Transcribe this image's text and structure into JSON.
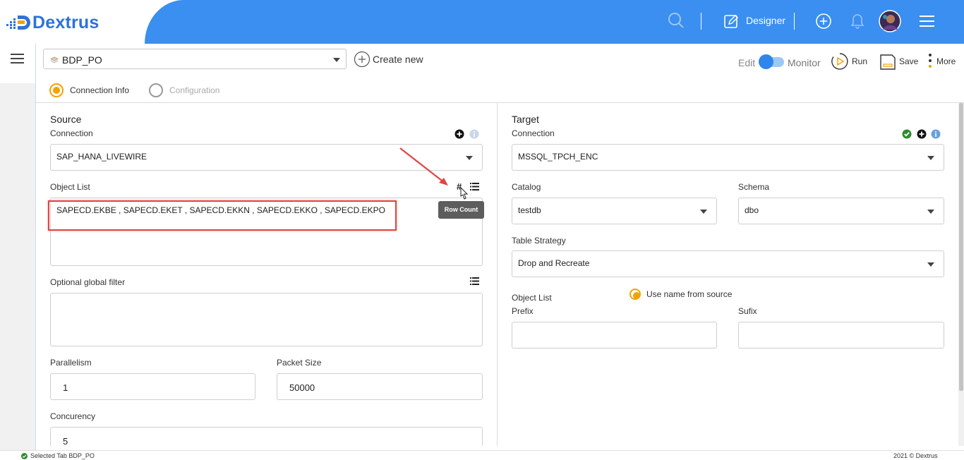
{
  "app": {
    "logo_text": "Dextrus"
  },
  "header": {
    "designer_label": "Designer"
  },
  "project": {
    "name": "BDP_PO",
    "create_new_label": "Create new"
  },
  "toolbar": {
    "edit_label": "Edit",
    "monitor_label": "Monitor",
    "run_label": "Run",
    "save_label": "Save",
    "more_label": "More"
  },
  "steps": [
    {
      "label": "Connection Info",
      "selected": true
    },
    {
      "label": "Configuration",
      "selected": false
    }
  ],
  "source": {
    "title": "Source",
    "connection_label": "Connection",
    "connection_value": "SAP_HANA_LIVEWIRE",
    "object_list_label": "Object List",
    "object_list_value": "SAPECD.EKBE , SAPECD.EKET , SAPECD.EKKN , SAPECD.EKKO , SAPECD.EKPO",
    "row_count_tooltip": "Row Count",
    "global_filter_label": "Optional global filter",
    "parallelism_label": "Parallelism",
    "parallelism_value": "1",
    "packet_size_label": "Packet Size",
    "packet_size_value": "50000",
    "concurrency_label": "Concurency",
    "concurrency_value": "5"
  },
  "target": {
    "title": "Target",
    "connection_label": "Connection",
    "connection_value": "MSSQL_TPCH_ENC",
    "catalog_label": "Catalog",
    "catalog_value": "testdb",
    "schema_label": "Schema",
    "schema_value": "dbo",
    "table_strategy_label": "Table Strategy",
    "table_strategy_value": "Drop and Recreate",
    "object_list_label": "Object List",
    "use_name_label": "Use name from source",
    "prefix_label": "Prefix",
    "sufix_label": "Sufix"
  },
  "footer": {
    "status_text": "Selected Tab BDP_PO",
    "copyright": "2021 © Dextrus"
  },
  "colors": {
    "header_blue": "#3a8ff0",
    "accent_orange": "#f5a100",
    "highlight_red": "#e14444",
    "success_green": "#2e8b2e"
  }
}
